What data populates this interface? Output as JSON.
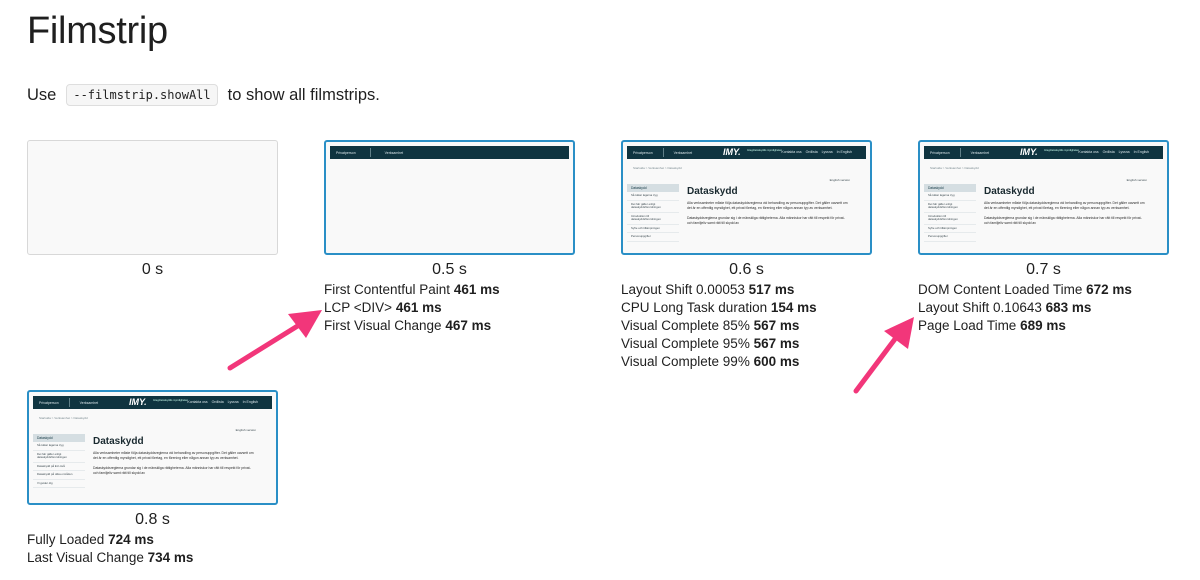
{
  "title": "Filmstrip",
  "intro": {
    "before": "Use",
    "code": "--filmstrip.showAll",
    "after": "to show all filmstrips."
  },
  "site": {
    "nav": [
      "Privatperson",
      "Verksamhet"
    ],
    "logo": "IMY.",
    "logo_sub": "Integritetsskydds myndigheten",
    "nav_links": [
      "Kontakta oss",
      "Ordlista",
      "Lyssna",
      "In English"
    ],
    "breadcrumb": "Startsida > Verksamhet > Dataskydd",
    "english": "English version",
    "heading": "Dataskydd",
    "paragraph1": "Alla verksamheter måste följa dataskyddsreglerna vid behandling av personuppgifter. Det gäller oavsett om det är en offentlig myndighet, ett privat företag, en förening eller någon annan typ av verksamhet.",
    "paragraph2": "Dataskyddsreglerna grundar sig i de mänskliga rättigheterna. Alla människor har rätt till respekt för privat- och familjeliv samt rätt till skydd av",
    "sidebar_active": "Dataskydd",
    "sidebar": [
      "Så tolkar lagarna tryg",
      "Det här gäller enligt dataskyddsförordningen",
      "Introduktion till dataskyddsförordningen",
      "Syfte och tillämpningen",
      "Personuppgifter"
    ],
    "sidebar_alt": [
      "Så tolkar lagarna tryg",
      "Det här gäller enligt dataskyddsförordningen",
      "Dataskydd på EU-nivå",
      "Dataskydd på olika områden",
      "Vi guider dig"
    ]
  },
  "frames": [
    {
      "time": "0 s",
      "metrics": []
    },
    {
      "time": "0.5 s",
      "metrics": [
        {
          "label": "First Contentful Paint",
          "value": "461 ms"
        },
        {
          "label": "LCP <DIV>",
          "value": "461 ms"
        },
        {
          "label": "First Visual Change",
          "value": "467 ms"
        }
      ]
    },
    {
      "time": "0.6 s",
      "metrics": [
        {
          "label": "Layout Shift 0.00053",
          "value": "517 ms"
        },
        {
          "label": "CPU Long Task duration",
          "value": "154 ms"
        },
        {
          "label": "Visual Complete 85%",
          "value": "567 ms"
        },
        {
          "label": "Visual Complete 95%",
          "value": "567 ms"
        },
        {
          "label": "Visual Complete 99%",
          "value": "600 ms"
        }
      ]
    },
    {
      "time": "0.7 s",
      "metrics": [
        {
          "label": "DOM Content Loaded Time",
          "value": "672 ms"
        },
        {
          "label": "Layout Shift 0.10643",
          "value": "683 ms"
        },
        {
          "label": "Page Load Time",
          "value": "689 ms"
        }
      ]
    },
    {
      "time": "0.8 s",
      "metrics": [
        {
          "label": "Fully Loaded",
          "value": "724 ms"
        },
        {
          "label": "Last Visual Change",
          "value": "734 ms"
        }
      ]
    }
  ],
  "colors": {
    "accent_border": "#2a8fc6",
    "nav_bg": "#0f3440",
    "arrow": "#f2367a"
  }
}
